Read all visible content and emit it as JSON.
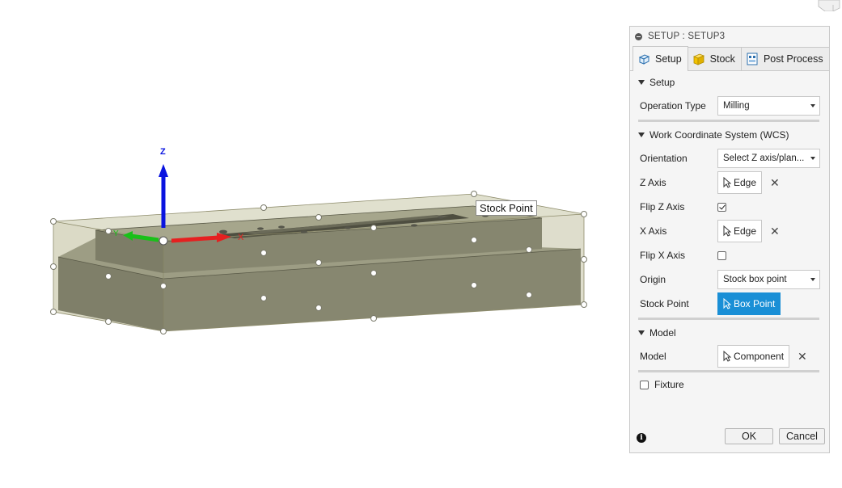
{
  "viewport": {
    "axis_labels": {
      "z": "Z",
      "x": "X",
      "y": "Y"
    },
    "tooltip": "Stock Point",
    "colors": {
      "stock_box": "#b7b592",
      "part": "#86866e",
      "z_axis": "#0a14e0",
      "x_axis": "#e52020",
      "y_axis": "#19c019"
    }
  },
  "panel": {
    "title": "SETUP : SETUP3",
    "tabs": [
      {
        "label": "Setup",
        "icon": "setup-icon"
      },
      {
        "label": "Stock",
        "icon": "stock-cube-icon"
      },
      {
        "label": "Post Process",
        "icon": "post-process-icon"
      }
    ],
    "setup_section": {
      "heading": "Setup",
      "operation_type_label": "Operation Type",
      "operation_type_value": "Milling"
    },
    "wcs_section": {
      "heading": "Work Coordinate System (WCS)",
      "orientation_label": "Orientation",
      "orientation_value": "Select Z axis/plan...",
      "z_axis_label": "Z Axis",
      "z_axis_value": "Edge",
      "flip_z_label": "Flip Z Axis",
      "flip_z_checked": true,
      "x_axis_label": "X Axis",
      "x_axis_value": "Edge",
      "flip_x_label": "Flip X Axis",
      "flip_x_checked": false,
      "origin_label": "Origin",
      "origin_value": "Stock box point",
      "stock_point_label": "Stock Point",
      "stock_point_value": "Box Point"
    },
    "model_section": {
      "heading": "Model",
      "model_label": "Model",
      "model_value": "Component"
    },
    "fixture_label": "Fixture",
    "ok_label": "OK",
    "cancel_label": "Cancel",
    "accent_color": "#1a8fd6"
  }
}
